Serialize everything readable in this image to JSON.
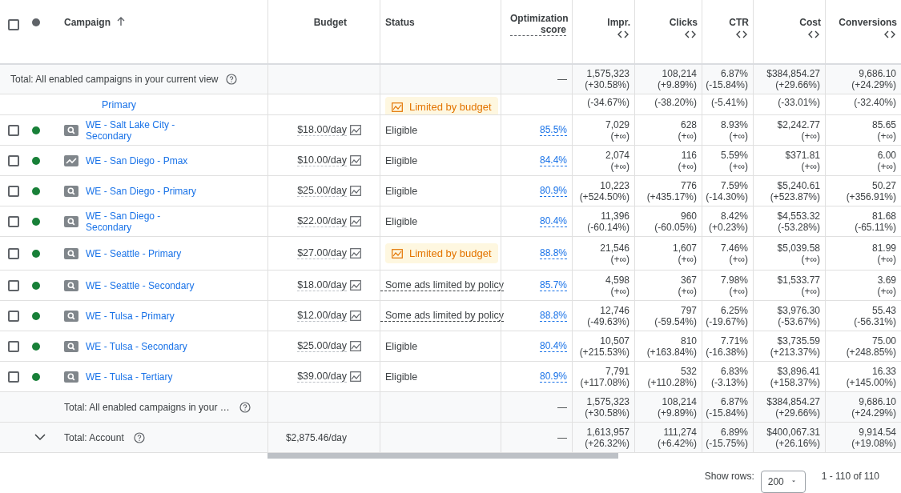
{
  "header": {
    "columns": [
      {
        "label": "Campaign",
        "kind": "sort"
      },
      {
        "label": "Budget",
        "kind": "plain"
      },
      {
        "label": "Status",
        "kind": "left"
      },
      {
        "label": "Optimization score",
        "kind": "dashed"
      },
      {
        "label": "Impr.",
        "kind": "toggle"
      },
      {
        "label": "Clicks",
        "kind": "toggle"
      },
      {
        "label": "CTR",
        "kind": "toggle"
      },
      {
        "label": "Cost",
        "kind": "toggle"
      },
      {
        "label": "Conversions",
        "kind": "toggle"
      }
    ],
    "checked": false
  },
  "top_total": {
    "label": "Total: All enabled campaigns in your current view",
    "score": "—",
    "metrics": [
      {
        "value": "1,575,323",
        "change": "(+30.58%)"
      },
      {
        "value": "108,214",
        "change": "(+9.89%)"
      },
      {
        "value": "6.87%",
        "change": "(-15.84%)"
      },
      {
        "value": "$384,854.27",
        "change": "(+29.66%)"
      },
      {
        "value": "9,686.10",
        "change": "(+24.29%)"
      }
    ]
  },
  "cut_row": {
    "name": "Primary",
    "status": {
      "kind": "limited",
      "label": "Limited by budget"
    },
    "metrics": [
      {
        "change": "(-34.67%)"
      },
      {
        "change": "(-38.20%)"
      },
      {
        "change": "(-5.41%)"
      },
      {
        "change": "(-33.01%)"
      },
      {
        "change": "(-32.40%)"
      }
    ]
  },
  "rows": [
    {
      "checked": false,
      "color": "#188038",
      "kind": "search",
      "name": "WE - Salt Lake City - Secondary",
      "budget": "$18.00/day",
      "status": {
        "kind": "eligible",
        "label": "Eligible"
      },
      "score": "85.5%",
      "metrics": [
        {
          "value": "7,029",
          "change": "(+∞)"
        },
        {
          "value": "628",
          "change": "(+∞)"
        },
        {
          "value": "8.93%",
          "change": "(+∞)"
        },
        {
          "value": "$2,242.77",
          "change": "(+∞)"
        },
        {
          "value": "85.65",
          "change": "(+∞)"
        }
      ]
    },
    {
      "checked": false,
      "color": "#188038",
      "kind": "pmax",
      "name": "WE - San Diego - Pmax",
      "budget": "$10.00/day",
      "status": {
        "kind": "eligible",
        "label": "Eligible"
      },
      "score": "84.4%",
      "metrics": [
        {
          "value": "2,074",
          "change": "(+∞)"
        },
        {
          "value": "116",
          "change": "(+∞)"
        },
        {
          "value": "5.59%",
          "change": "(+∞)"
        },
        {
          "value": "$371.81",
          "change": "(+∞)"
        },
        {
          "value": "6.00",
          "change": "(+∞)"
        }
      ]
    },
    {
      "checked": false,
      "color": "#188038",
      "kind": "search",
      "name": "WE - San Diego - Primary",
      "budget": "$25.00/day",
      "status": {
        "kind": "eligible",
        "label": "Eligible"
      },
      "score": "80.9%",
      "metrics": [
        {
          "value": "10,223",
          "change": "(+524.50%)"
        },
        {
          "value": "776",
          "change": "(+435.17%)"
        },
        {
          "value": "7.59%",
          "change": "(-14.30%)"
        },
        {
          "value": "$5,240.61",
          "change": "(+523.87%)"
        },
        {
          "value": "50.27",
          "change": "(+356.91%)"
        }
      ]
    },
    {
      "checked": false,
      "color": "#188038",
      "kind": "search",
      "name": "WE - San Diego - Secondary",
      "budget": "$22.00/day",
      "status": {
        "kind": "eligible",
        "label": "Eligible"
      },
      "score": "80.4%",
      "metrics": [
        {
          "value": "11,396",
          "change": "(-60.14%)"
        },
        {
          "value": "960",
          "change": "(-60.05%)"
        },
        {
          "value": "8.42%",
          "change": "(+0.23%)"
        },
        {
          "value": "$4,553.32",
          "change": "(-53.28%)"
        },
        {
          "value": "81.68",
          "change": "(-65.11%)"
        }
      ]
    },
    {
      "checked": false,
      "color": "#188038",
      "kind": "search",
      "name": "WE - Seattle - Primary",
      "budget": "$27.00/day",
      "status": {
        "kind": "limited",
        "label": "Limited by budget"
      },
      "score": "88.8%",
      "metrics": [
        {
          "value": "21,546",
          "change": "(+∞)"
        },
        {
          "value": "1,607",
          "change": "(+∞)"
        },
        {
          "value": "7.46%",
          "change": "(+∞)"
        },
        {
          "value": "$5,039.58",
          "change": "(+∞)"
        },
        {
          "value": "81.99",
          "change": "(+∞)"
        }
      ]
    },
    {
      "checked": false,
      "color": "#188038",
      "kind": "search",
      "name": "WE - Seattle - Secondary",
      "budget": "$18.00/day",
      "status": {
        "kind": "policy",
        "label": "Some ads limited by policy"
      },
      "score": "85.7%",
      "metrics": [
        {
          "value": "4,598",
          "change": "(+∞)"
        },
        {
          "value": "367",
          "change": "(+∞)"
        },
        {
          "value": "7.98%",
          "change": "(+∞)"
        },
        {
          "value": "$1,533.77",
          "change": "(+∞)"
        },
        {
          "value": "3.69",
          "change": "(+∞)"
        }
      ]
    },
    {
      "checked": false,
      "color": "#188038",
      "kind": "search",
      "name": "WE - Tulsa - Primary",
      "budget": "$12.00/day",
      "status": {
        "kind": "policy",
        "label": "Some ads limited by policy"
      },
      "score": "88.8%",
      "metrics": [
        {
          "value": "12,746",
          "change": "(-49.63%)"
        },
        {
          "value": "797",
          "change": "(-59.54%)"
        },
        {
          "value": "6.25%",
          "change": "(-19.67%)"
        },
        {
          "value": "$3,976.30",
          "change": "(-53.67%)"
        },
        {
          "value": "55.43",
          "change": "(-56.31%)"
        }
      ]
    },
    {
      "checked": false,
      "color": "#188038",
      "kind": "search",
      "name": "WE - Tulsa - Secondary",
      "budget": "$25.00/day",
      "status": {
        "kind": "eligible",
        "label": "Eligible"
      },
      "score": "80.4%",
      "metrics": [
        {
          "value": "10,507",
          "change": "(+215.53%)"
        },
        {
          "value": "810",
          "change": "(+163.84%)"
        },
        {
          "value": "7.71%",
          "change": "(-16.38%)"
        },
        {
          "value": "$3,735.59",
          "change": "(+213.37%)"
        },
        {
          "value": "75.00",
          "change": "(+248.85%)"
        }
      ]
    },
    {
      "checked": false,
      "color": "#188038",
      "kind": "search",
      "name": "WE - Tulsa - Tertiary",
      "budget": "$39.00/day",
      "status": {
        "kind": "eligible",
        "label": "Eligible"
      },
      "score": "80.9%",
      "metrics": [
        {
          "value": "7,791",
          "change": "(+117.08%)"
        },
        {
          "value": "532",
          "change": "(+110.28%)"
        },
        {
          "value": "6.83%",
          "change": "(-3.13%)"
        },
        {
          "value": "$3,896.41",
          "change": "(+158.37%)"
        },
        {
          "value": "16.33",
          "change": "(+145.00%)"
        }
      ]
    }
  ],
  "bottom_total": {
    "label": "Total: All enabled campaigns in your …",
    "score": "—",
    "metrics": [
      {
        "value": "1,575,323",
        "change": "(+30.58%)"
      },
      {
        "value": "108,214",
        "change": "(+9.89%)"
      },
      {
        "value": "6.87%",
        "change": "(-15.84%)"
      },
      {
        "value": "$384,854.27",
        "change": "(+29.66%)"
      },
      {
        "value": "9,686.10",
        "change": "(+24.29%)"
      }
    ]
  },
  "account_total": {
    "label": "Total: Account",
    "budget": "$2,875.46/day",
    "score": "—",
    "expanded": false,
    "metrics": [
      {
        "value": "1,613,957",
        "change": "(+26.32%)"
      },
      {
        "value": "111,274",
        "change": "(+6.42%)"
      },
      {
        "value": "6.89%",
        "change": "(-15.75%)"
      },
      {
        "value": "$400,067.31",
        "change": "(+26.16%)"
      },
      {
        "value": "9,914.54",
        "change": "(+19.08%)"
      }
    ]
  },
  "pagination": {
    "label": "Show rows:",
    "rows_per_page": "200",
    "range": "1 - 110 of 110"
  }
}
